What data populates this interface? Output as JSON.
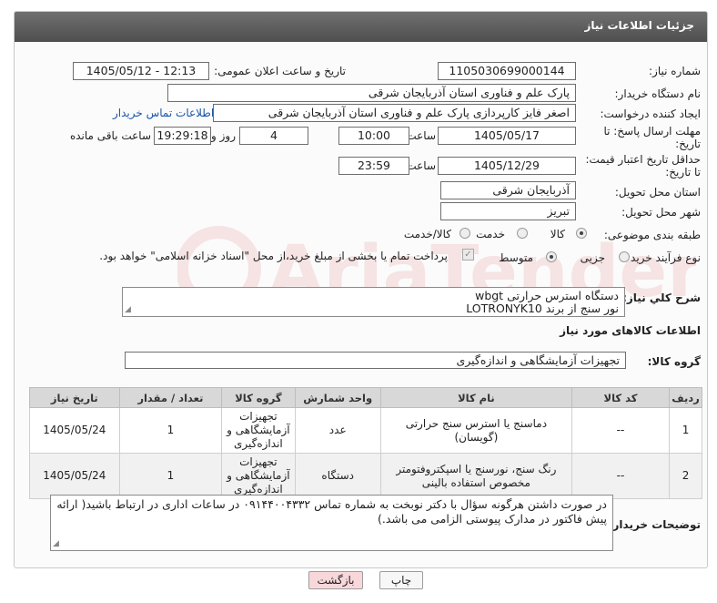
{
  "header": {
    "title": "جزئیات اطلاعات نیاز"
  },
  "fields": {
    "need_number_label": "شماره نیاز:",
    "need_number": "1105030699000144",
    "announce_label": "تاریخ و ساعت اعلان عمومی:",
    "announce_value": "1405/05/12 - 12:13",
    "buyer_label": "نام دستگاه خریدار:",
    "buyer_value": "پارک علم و فناوری استان آذربایجان شرقی",
    "creator_label": "ایجاد کننده درخواست:",
    "creator_value": "اصغر فایز کارپردازی پارک علم و فناوری استان آذربایجان شرقی",
    "contact_link": "اطلاعات تماس خریدار",
    "deadline_label_1": "مهلت ارسال پاسخ: تا",
    "deadline_label_2": "تاریخ:",
    "deadline_date": "1405/05/17",
    "time_label": "ساعت",
    "deadline_time": "10:00",
    "days_value": "4",
    "days_label": "روز و",
    "remaining_time": "19:29:18",
    "remaining_label": "ساعت باقی مانده",
    "validity_label_1": "حداقل تاریخ اعتبار قیمت:",
    "validity_label_2": "تا تاریخ:",
    "validity_date": "1405/12/29",
    "validity_time_label": "ساعت",
    "validity_time": "23:59",
    "province_label": "استان محل تحویل:",
    "province_value": "آذربایجان شرقی",
    "city_label": "شهر محل تحویل:",
    "city_value": "تبریز",
    "category_label": "طبقه بندی موضوعی:",
    "category_options": [
      "کالا",
      "خدمت",
      "کالا/خدمت"
    ],
    "process_label": "نوع فرآیند خرید :",
    "process_options": [
      "جزیی",
      "متوسط"
    ],
    "payment_note": "پرداخت تمام یا بخشی از مبلغ خرید،از محل \"اسناد خزانه اسلامی\" خواهد بود."
  },
  "description": {
    "label": "شرح کلي نياز:",
    "line1": "دستگاه استرس حرارتی wbgt",
    "line2": "نور سنج از برند LOTRONYK10"
  },
  "goods_section": {
    "title": "اطلاعات کالاهای مورد نیاز",
    "group_label": "گروه کالا:",
    "group_value": "تجهیزات آزمایشگاهی و اندازه‌گیری"
  },
  "table": {
    "headers": [
      "ردیف",
      "کد کالا",
      "نام کالا",
      "واحد شمارش",
      "گروه کالا",
      "تعداد / مقدار",
      "تاریخ نیاز"
    ],
    "rows": [
      {
        "row": "1",
        "code": "--",
        "name": "دماسنج یا استرس سنج حرارتی (گویسان)",
        "unit": "عدد",
        "group": "تجهیزات آزمایشگاهی و اندازه‌گیری",
        "qty": "1",
        "date": "1405/05/24"
      },
      {
        "row": "2",
        "code": "--",
        "name": "رنگ سنج، نورسنج یا اسپکتروفتومتر مخصوص استفاده بالینی",
        "unit": "دستگاه",
        "group": "تجهیزات آزمایشگاهی و اندازه‌گیری",
        "qty": "1",
        "date": "1405/05/24"
      }
    ]
  },
  "buyer_notes": {
    "label": "توضیحات خریدار:",
    "text": "در صورت داشتن هرگونه سؤال با دکتر نوبخت به شماره تماس ۰۹۱۴۴۰۰۴۳۳۲ در ساعات اداری در ارتباط باشید( ارائه پیش فاکتور در مدارک پیوستی الزامی می باشد.)"
  },
  "buttons": {
    "print": "چاپ",
    "back": "بازگشت"
  },
  "watermark": {
    "text": "AriaTender.neT"
  },
  "colors": {
    "header": "#5a5a5a",
    "link": "#1a56a8",
    "back_button": "#f8d7da"
  }
}
